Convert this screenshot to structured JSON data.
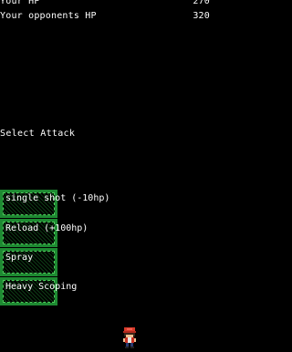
{
  "status": {
    "your_hp_label": "Your HP",
    "your_hp_value": "270",
    "opponent_hp_label": "Your opponents HP",
    "opponent_hp_value": "320"
  },
  "menu": {
    "title": "Select Attack",
    "attacks": [
      {
        "label": "single shot (-10hp)"
      },
      {
        "label": "Reload (+100hp)"
      },
      {
        "label": "Spray"
      },
      {
        "label": "Heavy Scoping"
      }
    ]
  },
  "sprite": {
    "icon": "trainer-sprite-icon"
  },
  "colors": {
    "background": "#000000",
    "text": "#ffffff",
    "button_border": "#1e8a32",
    "trainer_cap": "#d83a2a"
  }
}
